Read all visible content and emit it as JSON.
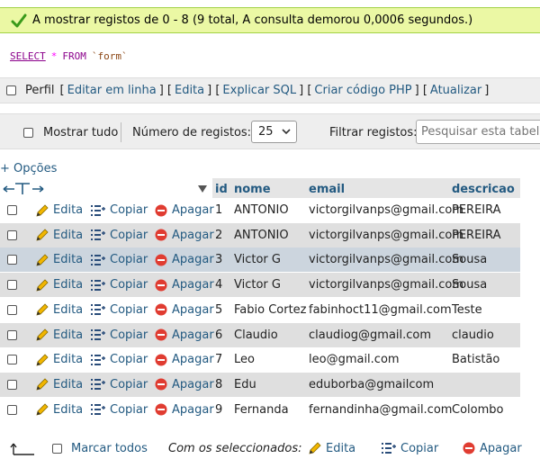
{
  "message": "A mostrar registos de 0 - 8 (9 total, A consulta demorou 0,0006 segundos.)",
  "sql": {
    "select": "SELECT",
    "star": "*",
    "from": "FROM",
    "table": "`form`"
  },
  "sql_tools": {
    "profile": "Perfil",
    "links": [
      "Editar em linha",
      "Edita",
      "Explicar SQL",
      "Criar código PHP",
      "Atualizar"
    ]
  },
  "nav": {
    "show_all": "Mostrar tudo",
    "records_label": "Número de registos:",
    "records_value": "25",
    "filter_label": "Filtrar registos:",
    "search_placeholder": "Pesquisar esta tabela"
  },
  "options_link": "+ Opções",
  "table": {
    "columns": [
      "id",
      "nome",
      "email",
      "descricao"
    ],
    "action_labels": {
      "edit": "Edita",
      "copy": "Copiar",
      "delete": "Apagar"
    },
    "rows": [
      {
        "id": "1",
        "nome": "ANTONIO",
        "email": "victorgilvanps@gmail.com",
        "descricao": "PEREIRA"
      },
      {
        "id": "2",
        "nome": "ANTONIO",
        "email": "victorgilvanps@gmail.com",
        "descricao": "PEREIRA"
      },
      {
        "id": "3",
        "nome": "Victor G",
        "email": "victorgilvanps@gmail.com",
        "descricao": "Sousa"
      },
      {
        "id": "4",
        "nome": "Victor G",
        "email": "victorgilvanps@gmail.com",
        "descricao": "Sousa"
      },
      {
        "id": "5",
        "nome": "Fabio Cortez",
        "email": "fabinhoct11@gmail.com",
        "descricao": "Teste"
      },
      {
        "id": "6",
        "nome": "Claudio",
        "email": "claudiog@gmail.com",
        "descricao": "claudio"
      },
      {
        "id": "7",
        "nome": "Leo",
        "email": "leo@gmail.com",
        "descricao": "Batistão"
      },
      {
        "id": "8",
        "nome": "Edu",
        "email": "eduborba@gmailcom",
        "descricao": ""
      },
      {
        "id": "9",
        "nome": "Fernanda",
        "email": "fernandinha@gmail.com",
        "descricao": "Colombo"
      }
    ],
    "highlighted_row": 2
  },
  "bottom": {
    "check_all": "Marcar todos",
    "with_selected": "Com os seleccionados:",
    "edit": "Edita",
    "copy": "Copiar",
    "delete": "Apagar"
  }
}
